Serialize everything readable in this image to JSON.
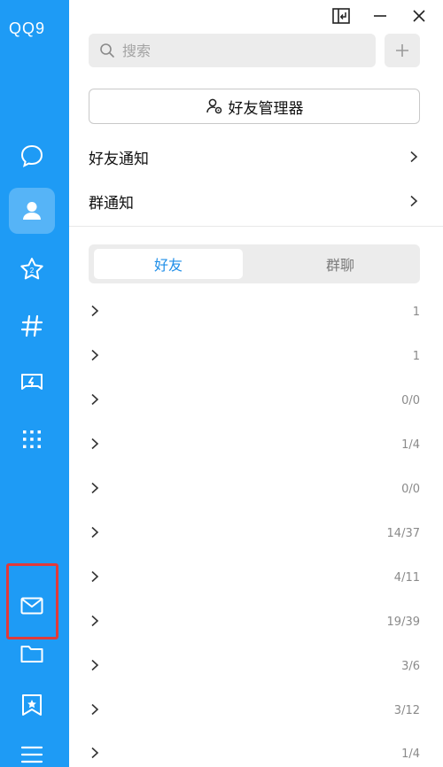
{
  "app": {
    "logo_text": "QQ9"
  },
  "colors": {
    "rail": "#1e9bf5",
    "accent": "#1e8ee8",
    "highlight": "#e03a3a"
  },
  "rail": {
    "items": [
      {
        "name": "message-icon",
        "active": false
      },
      {
        "name": "contacts-icon",
        "active": true
      },
      {
        "name": "star-zone-icon",
        "active": false
      },
      {
        "name": "hashtag-icon",
        "active": false
      },
      {
        "name": "game-icon",
        "active": false
      },
      {
        "name": "apps-grid-icon",
        "active": false
      },
      {
        "name": "mail-icon",
        "active": false
      },
      {
        "name": "folder-icon",
        "active": false
      },
      {
        "name": "bookmark-icon",
        "active": false
      },
      {
        "name": "menu-icon",
        "active": false
      }
    ]
  },
  "window": {
    "controls": [
      "pin-icon",
      "minimize-icon",
      "close-icon"
    ]
  },
  "search": {
    "placeholder": "搜索"
  },
  "friend_manager": {
    "label": "好友管理器"
  },
  "notifications": {
    "friend_notice": "好友通知",
    "group_notice": "群通知"
  },
  "tabs": {
    "friends": "好友",
    "groups": "群聊"
  },
  "groups": [
    {
      "name": "",
      "count": "1"
    },
    {
      "name": "",
      "count": "1"
    },
    {
      "name": "",
      "count": "0/0"
    },
    {
      "name": "",
      "count": "1/4"
    },
    {
      "name": "",
      "count": "0/0"
    },
    {
      "name": "",
      "count": "14/37"
    },
    {
      "name": "",
      "count": "4/11"
    },
    {
      "name": "",
      "count": "19/39"
    },
    {
      "name": "",
      "count": "3/6"
    },
    {
      "name": "",
      "count": "3/12"
    },
    {
      "name": "",
      "count": "1/4"
    }
  ]
}
